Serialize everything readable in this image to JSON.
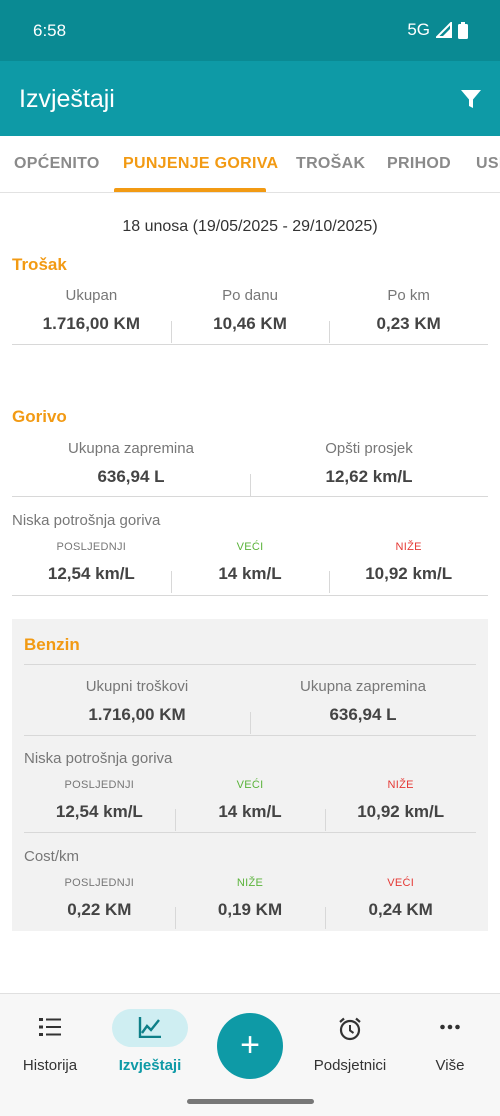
{
  "status": {
    "time": "6:58",
    "network": "5G"
  },
  "appbar": {
    "title": "Izvještaji"
  },
  "tabs": [
    "OPĆENITO",
    "PUNJENJE GORIVA",
    "TROŠAK",
    "PRIHOD",
    "USL"
  ],
  "summary": "18 unosa (19/05/2025 - 29/10/2025)",
  "trosak": {
    "title": "Trošak",
    "labels": [
      "Ukupan",
      "Po danu",
      "Po km"
    ],
    "values": [
      "1.716,00 KM",
      "10,46 KM",
      "0,23 KM"
    ]
  },
  "gorivo": {
    "title": "Gorivo",
    "labels": [
      "Ukupna zapremina",
      "Opšti prosjek"
    ],
    "values": [
      "636,94 L",
      "12,62 km/L"
    ],
    "sub_title": "Niska potrošnja goriva",
    "sub_labels": [
      "POSLJEDNJI",
      "VEĆI",
      "NIŽE"
    ],
    "sub_values": [
      "12,54 km/L",
      "14 km/L",
      "10,92 km/L"
    ]
  },
  "benzin": {
    "title": "Benzin",
    "labels": [
      "Ukupni troškovi",
      "Ukupna zapremina"
    ],
    "values": [
      "1.716,00 KM",
      "636,94 L"
    ],
    "cons_title": "Niska potrošnja goriva",
    "cons_labels": [
      "POSLJEDNJI",
      "VEĆI",
      "NIŽE"
    ],
    "cons_values": [
      "12,54 km/L",
      "14 km/L",
      "10,92 km/L"
    ],
    "cost_title": "Cost/km",
    "cost_labels": [
      "POSLJEDNJI",
      "NIŽE",
      "VEĆI"
    ],
    "cost_values": [
      "0,22 KM",
      "0,19 KM",
      "0,24 KM"
    ]
  },
  "nav": {
    "items": [
      "Historija",
      "Izvještaji",
      "Podsjetnici",
      "Više"
    ],
    "fab": "+"
  },
  "colors": {
    "primary": "#0e9aa6",
    "accent": "#f29a13",
    "green": "#5bb33b",
    "red": "#e53935"
  }
}
